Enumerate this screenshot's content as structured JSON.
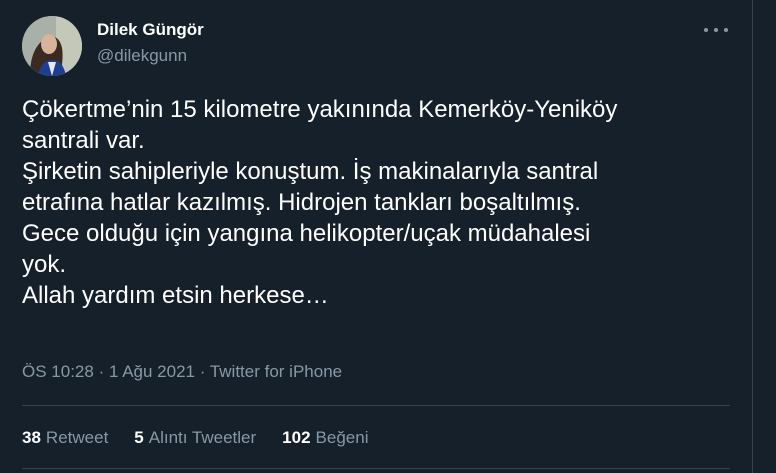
{
  "author": {
    "name": "Dilek Güngör",
    "handle": "@dilekgunn"
  },
  "tweet": {
    "text": "Çökertme’nin 15 kilometre yakınında Kemerköy-Yeniköy\nsantrali var.\nŞirketin sahipleriyle konuştum. İş makinalarıyla santral\netrafına hatlar kazılmış. Hidrojen tankları boşaltılmış.\nGece olduğu için yangına helikopter/uçak müdahalesi\nyok.\nAllah yardım etsin herkese…",
    "time": "ÖS 10:28",
    "separator": "·",
    "date": "1 Ağu 2021",
    "source": "Twitter for iPhone"
  },
  "stats": {
    "retweets": {
      "count": "38",
      "label": "Retweet"
    },
    "quotes": {
      "count": "5",
      "label": "Alıntı Tweetler"
    },
    "likes": {
      "count": "102",
      "label": "Beğeni"
    }
  },
  "colors": {
    "background": "#15202b",
    "text_primary": "#ffffff",
    "text_secondary": "#8899a6",
    "divider": "#38444d"
  },
  "icons": {
    "more": "more-dots-icon"
  }
}
